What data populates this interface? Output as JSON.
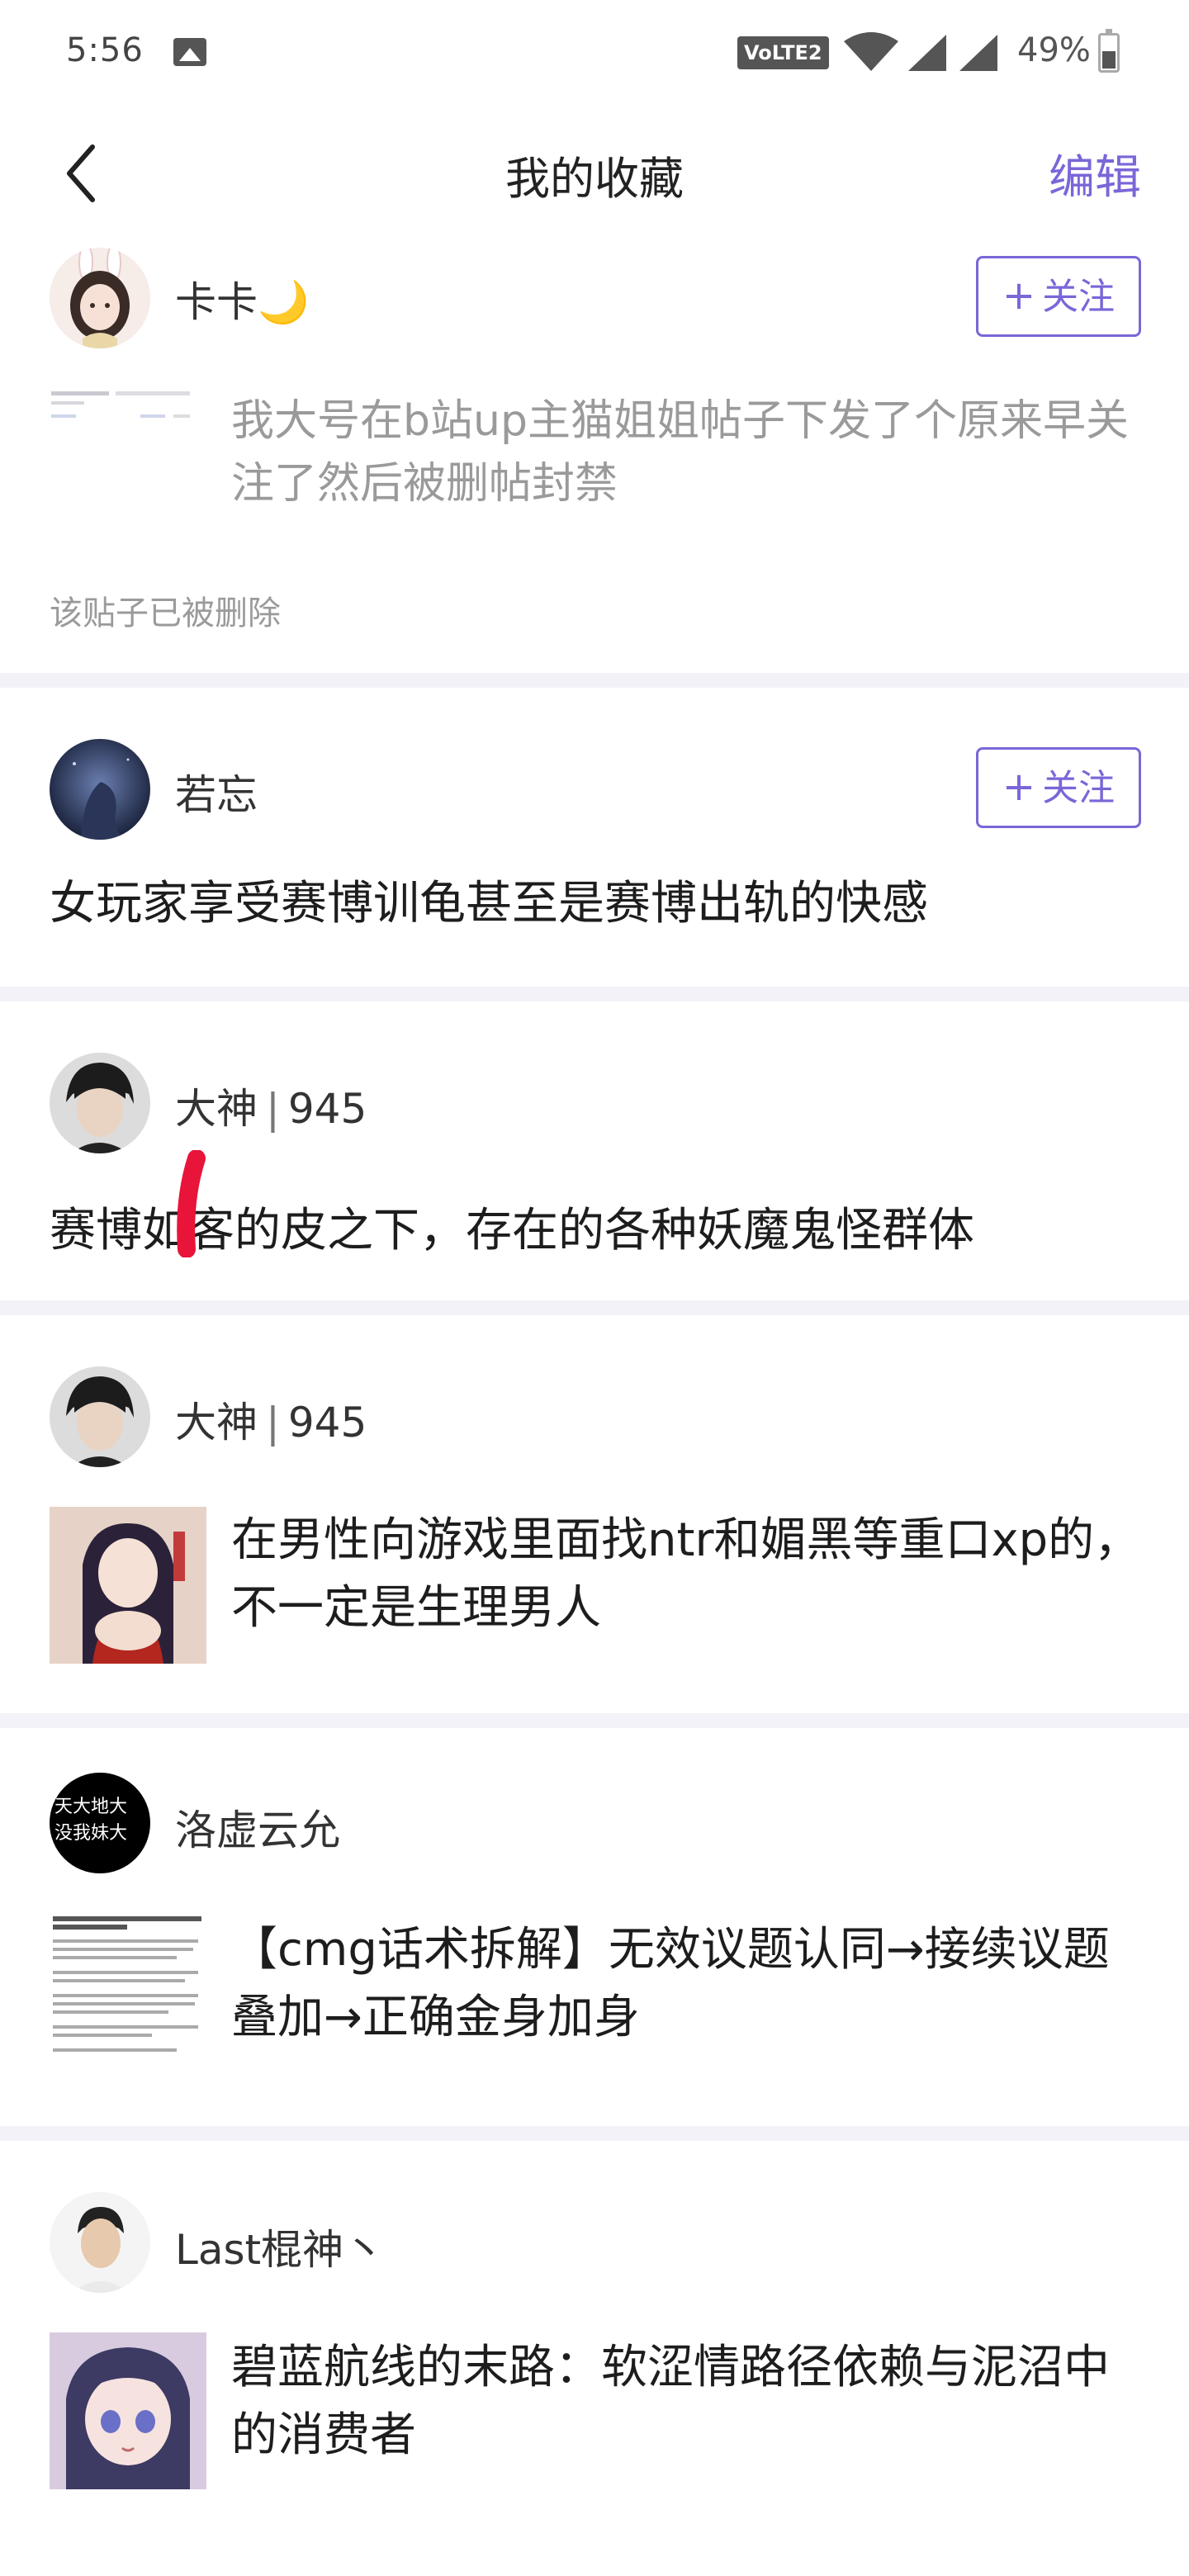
{
  "status_bar": {
    "time": "5:56",
    "volte": "VoLTE2",
    "battery": "49%",
    "battery_level": 0.49,
    "icons": [
      "gallery-icon",
      "wifi-icon",
      "signal-icon",
      "battery-icon"
    ]
  },
  "header": {
    "back_icon": "chevron-left-icon",
    "title": "我的收藏",
    "edit_label": "编辑",
    "accent_color": "#7b66d8"
  },
  "posts": [
    {
      "author": "卡卡🌙",
      "follow_label": "关注",
      "text": "我大号在b站up主猫姐姐帖子下发了个原来早关注了然后被删帖封禁",
      "note": "该贴子已被删除"
    },
    {
      "author": "若忘",
      "follow_label": "关注",
      "text": "女玩家享受赛博训龟甚至是赛博出轨的快感"
    },
    {
      "author": "大神",
      "level": "945",
      "text": "赛博如客的皮之下，存在的各种妖魔鬼怪群体"
    },
    {
      "author": "大神",
      "level": "945",
      "text": "在男性向游戏里面找ntr和媚黑等重口xp的，不一定是生理男人"
    },
    {
      "author": "洛虚云允",
      "avatar_text": [
        "天大地大",
        "没我妹大"
      ],
      "text": "【cmg话术拆解】无效议题认同→接续议题叠加→正确金身加身"
    },
    {
      "author": "Last棍神丶",
      "text": "碧蓝航线的末路：软涩情路径依赖与泥沼中的消费者"
    }
  ]
}
